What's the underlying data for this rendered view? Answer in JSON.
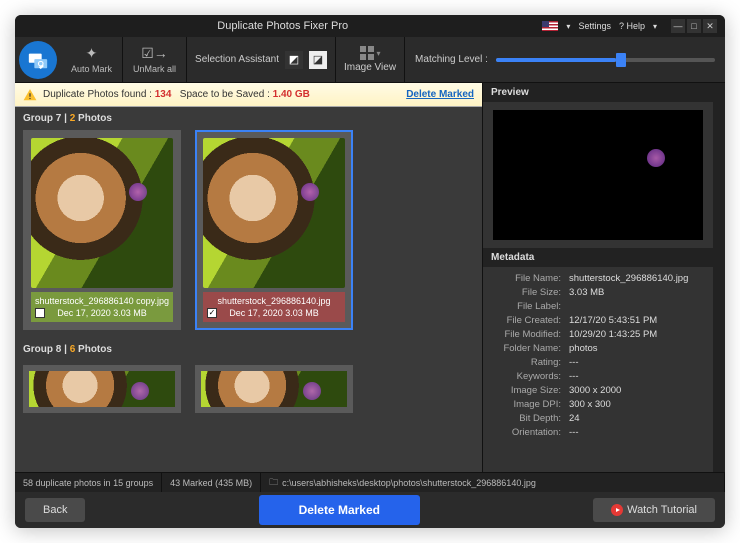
{
  "title": "Duplicate Photos Fixer Pro",
  "tb": {
    "settings": "Settings",
    "help": "? Help"
  },
  "toolbar": {
    "automark": "Auto Mark",
    "unmark": "UnMark all",
    "selassist": "Selection Assistant",
    "imgview": "Image View",
    "matching": "Matching Level :"
  },
  "info": {
    "found_lbl": "Duplicate Photos found :",
    "found": "134",
    "space_lbl": "Space to be Saved :",
    "space": "1.40 GB",
    "delete": "Delete Marked"
  },
  "g7": {
    "hdr": "Group 7 |",
    "cnt": "2",
    "photos": "Photos",
    "a": {
      "fn": "shutterstock_296886140 copy.jpg",
      "meta": "Dec 17, 2020    3.03 MB"
    },
    "b": {
      "fn": "shutterstock_296886140.jpg",
      "meta": "Dec 17, 2020    3.03 MB"
    }
  },
  "g8": {
    "hdr": "Group 8 |",
    "cnt": "6",
    "photos": "Photos"
  },
  "preview": {
    "hdr": "Preview"
  },
  "metahdr": "Metadata",
  "meta": [
    {
      "k": "File Name:",
      "v": "shutterstock_296886140.jpg"
    },
    {
      "k": "File Size:",
      "v": "3.03 MB"
    },
    {
      "k": "File Label:",
      "v": ""
    },
    {
      "k": "File Created:",
      "v": "12/17/20 5:43:51 PM"
    },
    {
      "k": "File Modified:",
      "v": "10/29/20 1:43:25 PM"
    },
    {
      "k": "Folder Name:",
      "v": "photos"
    },
    {
      "k": "Rating:",
      "v": "---"
    },
    {
      "k": "Keywords:",
      "v": "---"
    },
    {
      "k": "Image Size:",
      "v": "3000 x 2000"
    },
    {
      "k": "Image DPI:",
      "v": "300 x 300"
    },
    {
      "k": "Bit Depth:",
      "v": "24"
    },
    {
      "k": "Orientation:",
      "v": "---"
    }
  ],
  "status": {
    "s1": "58 duplicate photos in 15 groups",
    "s2": "43 Marked (435 MB)",
    "path": "c:\\users\\abhisheks\\desktop\\photos\\shutterstock_296886140.jpg"
  },
  "footer": {
    "back": "Back",
    "del": "Delete Marked",
    "watch": "Watch Tutorial"
  }
}
